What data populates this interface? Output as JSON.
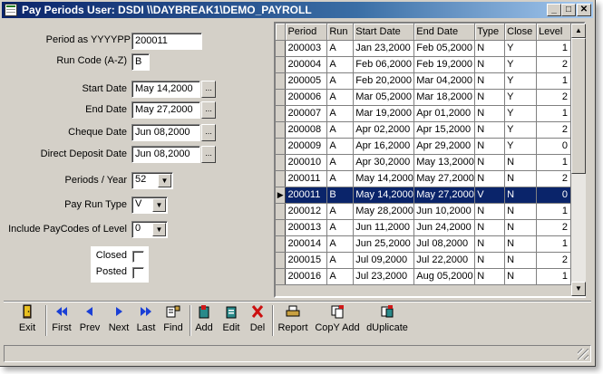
{
  "window": {
    "title": "Pay Periods  User: DSDI  \\\\DAYBREAK1\\DEMO_PAYROLL"
  },
  "form": {
    "period_label": "Period as YYYYPP",
    "period_value": "200011",
    "runcode_label": "Run Code (A-Z)",
    "runcode_value": "B",
    "start_label": "Start Date",
    "start_value": "May 14,2000",
    "end_label": "End Date",
    "end_value": "May 27,2000",
    "cheque_label": "Cheque Date",
    "cheque_value": "Jun 08,2000",
    "deposit_label": "Direct Deposit Date",
    "deposit_value": "Jun 08,2000",
    "periods_label": "Periods  / Year",
    "periods_value": "52",
    "runtype_label": "Pay Run Type",
    "runtype_value": "V",
    "level_label": "Include PayCodes of Level",
    "level_value": "0",
    "closed_label": "Closed",
    "posted_label": "Posted",
    "ellipsis": "..."
  },
  "grid": {
    "columns": [
      "Period",
      "Run",
      "Start Date",
      "End Date",
      "Type",
      "Close",
      "Level"
    ],
    "selected_indicator": "▶",
    "rows": [
      [
        "200003",
        "A",
        "Jan 23,2000",
        "Feb 05,2000",
        "N",
        "Y",
        "1"
      ],
      [
        "200004",
        "A",
        "Feb 06,2000",
        "Feb 19,2000",
        "N",
        "Y",
        "2"
      ],
      [
        "200005",
        "A",
        "Feb 20,2000",
        "Mar 04,2000",
        "N",
        "Y",
        "1"
      ],
      [
        "200006",
        "A",
        "Mar 05,2000",
        "Mar 18,2000",
        "N",
        "Y",
        "2"
      ],
      [
        "200007",
        "A",
        "Mar 19,2000",
        "Apr 01,2000",
        "N",
        "Y",
        "1"
      ],
      [
        "200008",
        "A",
        "Apr 02,2000",
        "Apr 15,2000",
        "N",
        "Y",
        "2"
      ],
      [
        "200009",
        "A",
        "Apr 16,2000",
        "Apr 29,2000",
        "N",
        "Y",
        "0"
      ],
      [
        "200010",
        "A",
        "Apr 30,2000",
        "May 13,2000",
        "N",
        "N",
        "1"
      ],
      [
        "200011",
        "A",
        "May 14,2000",
        "May 27,2000",
        "N",
        "N",
        "2"
      ],
      [
        "200011",
        "B",
        "May 14,2000",
        "May 27,2000",
        "V",
        "N",
        "0"
      ],
      [
        "200012",
        "A",
        "May 28,2000",
        "Jun 10,2000",
        "N",
        "N",
        "1"
      ],
      [
        "200013",
        "A",
        "Jun 11,2000",
        "Jun 24,2000",
        "N",
        "N",
        "2"
      ],
      [
        "200014",
        "A",
        "Jun 25,2000",
        "Jul 08,2000",
        "N",
        "N",
        "1"
      ],
      [
        "200015",
        "A",
        "Jul 09,2000",
        "Jul 22,2000",
        "N",
        "N",
        "2"
      ],
      [
        "200016",
        "A",
        "Jul 23,2000",
        "Aug 05,2000",
        "N",
        "N",
        "1"
      ]
    ],
    "selected_row": 9
  },
  "toolbar": [
    {
      "name": "exit",
      "label": "Exit",
      "icon": "exit-door-icon"
    },
    {
      "name": "first",
      "label": "First",
      "icon": "first-record-icon"
    },
    {
      "name": "prev",
      "label": "Prev",
      "icon": "prev-record-icon"
    },
    {
      "name": "next",
      "label": "Next",
      "icon": "next-record-icon"
    },
    {
      "name": "last",
      "label": "Last",
      "icon": "last-record-icon"
    },
    {
      "name": "find",
      "label": "Find",
      "icon": "find-icon"
    },
    {
      "name": "add",
      "label": "Add",
      "icon": "add-record-icon"
    },
    {
      "name": "edit",
      "label": "Edit",
      "icon": "edit-record-icon"
    },
    {
      "name": "del",
      "label": "Del",
      "icon": "delete-x-icon"
    },
    {
      "name": "report",
      "label": "Report",
      "icon": "report-printer-icon"
    },
    {
      "name": "copyadd",
      "label": "CopY Add",
      "icon": "copy-add-icon"
    },
    {
      "name": "duplicate",
      "label": "dUplicate",
      "icon": "duplicate-icon"
    }
  ],
  "colors": {
    "title_bar": "#0a246a",
    "selection": "#0a246a",
    "face": "#d4d0c8",
    "nav_blue": "#1a3fd6",
    "delete_red": "#cc1010"
  }
}
